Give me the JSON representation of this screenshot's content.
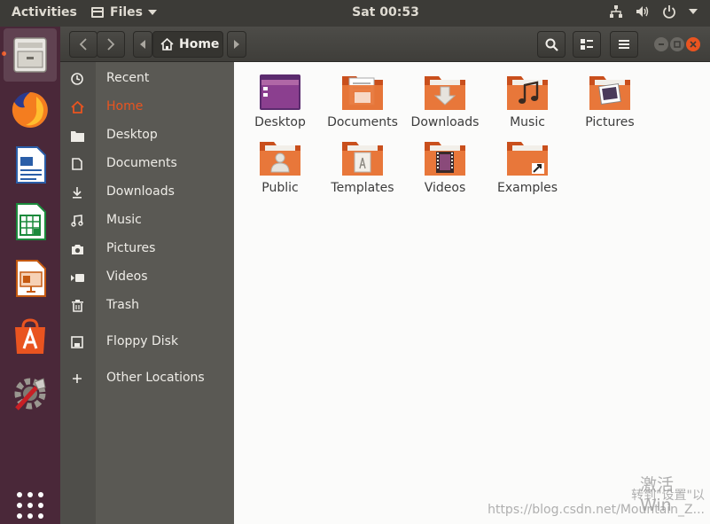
{
  "topbar": {
    "activities": "Activities",
    "app_menu": "Files",
    "clock": "Sat 00:53"
  },
  "dock": {
    "items": [
      "files-icon",
      "firefox-icon",
      "writer-icon",
      "calc-icon",
      "impress-icon",
      "software-icon",
      "settings-icon",
      "show-apps-icon"
    ]
  },
  "headerbar": {
    "path": "Home"
  },
  "sidebar": {
    "items": [
      {
        "label": "Recent",
        "icon": "clock-icon"
      },
      {
        "label": "Home",
        "icon": "home-icon"
      },
      {
        "label": "Desktop",
        "icon": "folder-icon"
      },
      {
        "label": "Documents",
        "icon": "document-icon"
      },
      {
        "label": "Downloads",
        "icon": "download-icon"
      },
      {
        "label": "Music",
        "icon": "music-icon"
      },
      {
        "label": "Pictures",
        "icon": "camera-icon"
      },
      {
        "label": "Videos",
        "icon": "video-icon"
      },
      {
        "label": "Trash",
        "icon": "trash-icon"
      },
      {
        "label": "Floppy Disk",
        "icon": "floppy-icon"
      },
      {
        "label": "Other Locations",
        "icon": "plus-icon"
      }
    ]
  },
  "files": [
    {
      "label": "Desktop"
    },
    {
      "label": "Documents"
    },
    {
      "label": "Downloads"
    },
    {
      "label": "Music"
    },
    {
      "label": "Pictures"
    },
    {
      "label": "Public"
    },
    {
      "label": "Templates"
    },
    {
      "label": "Videos"
    },
    {
      "label": "Examples"
    }
  ],
  "watermark": {
    "activate_title": "激活 Win",
    "activate_sub": "转到\"设置\"以",
    "url": "https://blog.csdn.net/Mountain_Z..."
  },
  "colors": {
    "accent": "#e95420",
    "folder": "#e06a2c",
    "dock_bg": "#4a2839",
    "topbar_bg": "#3c3b37"
  }
}
